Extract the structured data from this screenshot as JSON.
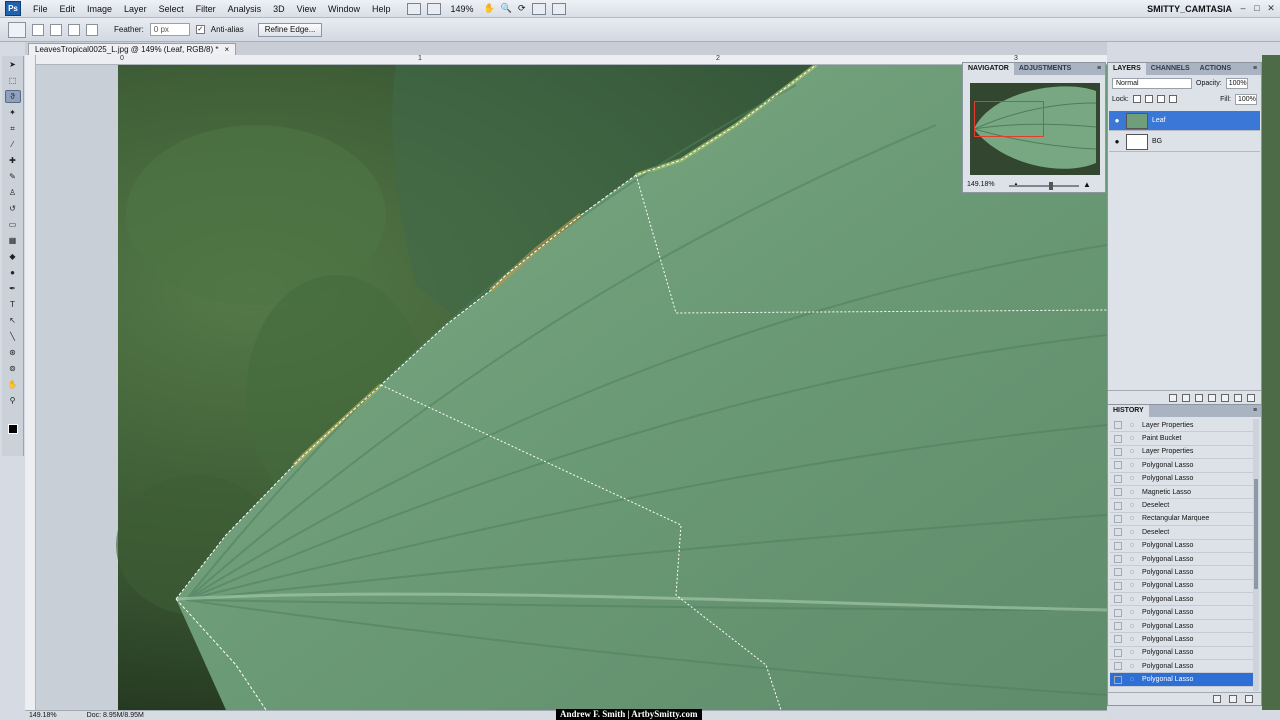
{
  "app": {
    "logo": "Ps",
    "workspace": "SMITTY_CAMTASIA"
  },
  "menu": [
    "File",
    "Edit",
    "Image",
    "Layer",
    "Select",
    "Filter",
    "Analysis",
    "3D",
    "View",
    "Window",
    "Help"
  ],
  "menubar_zoom": "149%",
  "options": {
    "feather_label": "Feather:",
    "feather_value": "0 px",
    "antialias_label": "Anti-alias",
    "antialias_checked": true,
    "refine_edge": "Refine Edge..."
  },
  "document": {
    "tab_title": "LeavesTropical0025_L.jpg @ 149% (Leaf, RGB/8) *"
  },
  "ruler": {
    "top_numbers": [
      "0",
      "1",
      "2",
      "3"
    ]
  },
  "status": {
    "zoom": "149.18%",
    "doc": "Doc: 8.95M/8.95M"
  },
  "watermark": "Andrew F. Smith | ArtbySmitty.com",
  "navigator": {
    "tabs": [
      "NAVIGATOR",
      "ADJUSTMENTS"
    ],
    "zoom": "149.18%"
  },
  "layers": {
    "tabs": [
      "LAYERS",
      "CHANNELS",
      "ACTIONS"
    ],
    "blend_mode": "Normal",
    "opacity_label": "Opacity:",
    "opacity": "100%",
    "lock_label": "Lock:",
    "fill_label": "Fill:",
    "fill": "100%",
    "items": [
      {
        "name": "Leaf",
        "selected": true
      },
      {
        "name": "BG",
        "selected": false
      }
    ]
  },
  "history": {
    "title": "HISTORY",
    "items": [
      "Layer Properties",
      "Paint Bucket",
      "Layer Properties",
      "Polygonal Lasso",
      "Polygonal Lasso",
      "Magnetic Lasso",
      "Deselect",
      "Rectangular Marquee",
      "Deselect",
      "Polygonal Lasso",
      "Polygonal Lasso",
      "Polygonal Lasso",
      "Polygonal Lasso",
      "Polygonal Lasso",
      "Polygonal Lasso",
      "Polygonal Lasso",
      "Polygonal Lasso",
      "Polygonal Lasso",
      "Polygonal Lasso",
      "Polygonal Lasso"
    ],
    "active_index": 19
  },
  "colors": {
    "selection": "#3a77d6",
    "leaf": "#6e9a78",
    "background": "#3f5a36"
  }
}
